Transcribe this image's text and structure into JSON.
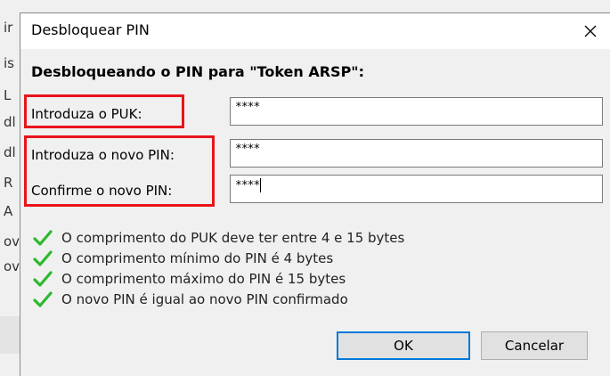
{
  "background": {
    "fragments": [
      "ir",
      "is",
      "L",
      "dl",
      "dl",
      "R",
      "A",
      "ov",
      "ov"
    ]
  },
  "dialog": {
    "title": "Desbloquear PIN",
    "close_glyph": "✕",
    "heading": "Desbloqueando o PIN para \"Token ARSP\":",
    "fields": {
      "puk": {
        "label": "Introduza o PUK:",
        "value": "****"
      },
      "new_pin": {
        "label": "Introduza o novo PIN:",
        "value": "****"
      },
      "confirm_pin": {
        "label": "Confirme o novo PIN:",
        "value": "****"
      }
    },
    "checks": [
      "O comprimento do PUK deve ter entre 4 e 15 bytes",
      "O comprimento mínimo do PIN é 4 bytes",
      "O comprimento máximo do PIN é 15 bytes",
      "O novo PIN é igual ao novo PIN confirmado"
    ],
    "buttons": {
      "ok": "OK",
      "cancel": "Cancelar"
    }
  },
  "colors": {
    "highlight_border": "#e8141a",
    "check_icon": "#2db82d",
    "default_button_border": "#0078d7"
  },
  "icons": {
    "check": "checkmark-icon",
    "close": "close-icon"
  }
}
